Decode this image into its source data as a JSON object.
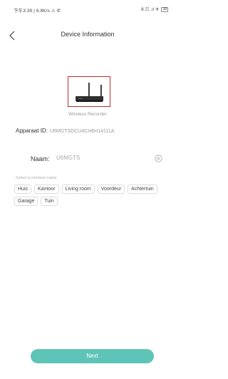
{
  "status_bar": {
    "left_text": "下午3:39 | 6.8K/s ⚠ ✆",
    "right_text": "8 ☷ .ıl ✈",
    "battery": "38"
  },
  "header": {
    "title": "Device Information",
    "back_icon": "chevron-left-icon"
  },
  "device": {
    "image_icon": "wireless-recorder-icon",
    "caption": "Wireless Recorder"
  },
  "apparaat": {
    "label": "Apparaat ID:",
    "value": "U6MGTSDCU4CH6H14111A"
  },
  "name_field": {
    "label": "Naam:",
    "value": "U6MGTS",
    "clear_icon": "clear-icon"
  },
  "common_names": {
    "hint": "Select a common name",
    "chips": [
      "Huis",
      "Kantoor",
      "Living room",
      "Voordeur",
      "Achtertuin",
      "Garage",
      "Tuin"
    ]
  },
  "footer": {
    "next_label": "Next"
  },
  "colors": {
    "accent": "#5fc4b8",
    "frame": "#c52a2a"
  }
}
